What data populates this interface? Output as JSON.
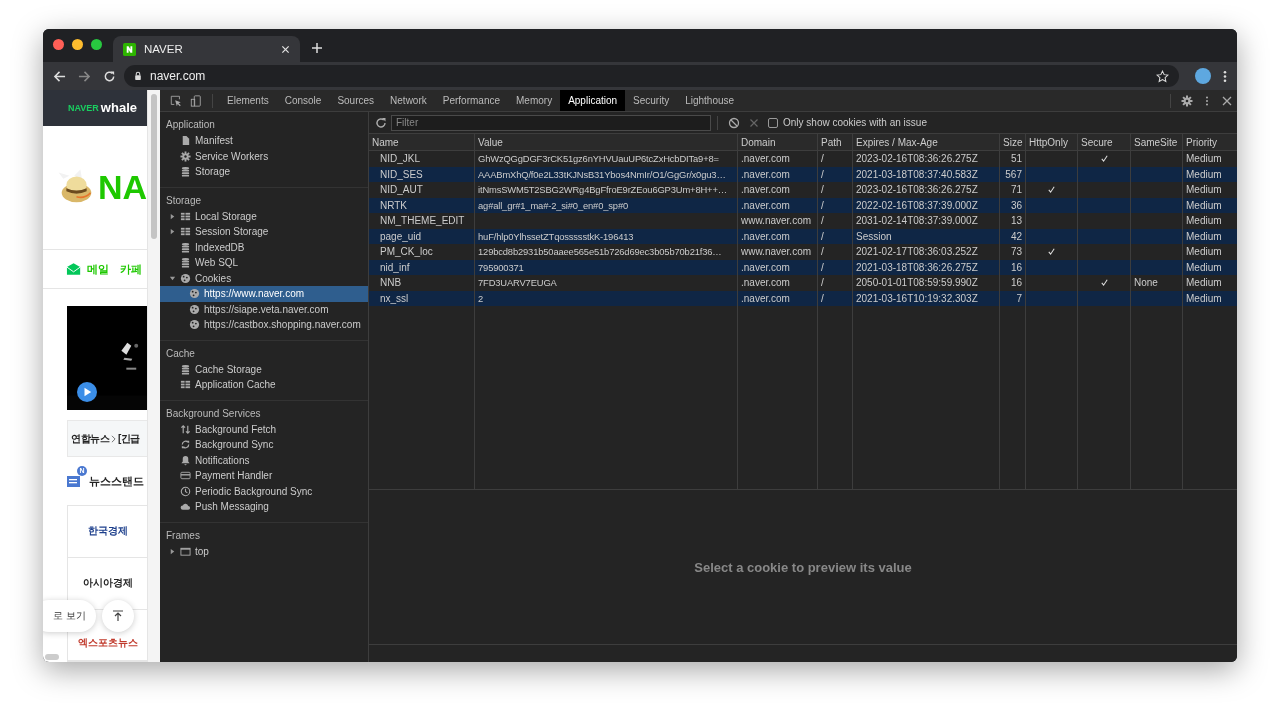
{
  "browser": {
    "tab_title": "NAVER",
    "url": "naver.com"
  },
  "page": {
    "brand_naver": "NAVER",
    "brand_whale": "whale",
    "logo_text": "NA",
    "mail": "메일",
    "cafe": "카페",
    "news_source": "연합뉴스",
    "headline": "[긴급",
    "newsstand": "뉴스스탠드",
    "newsstand_badge": "N",
    "press": [
      "한국경제",
      "아시아경제",
      "엑스포츠뉴스"
    ],
    "view_toggle": "로 보기"
  },
  "devtools": {
    "tabs": [
      {
        "label": "Elements",
        "selected": false
      },
      {
        "label": "Console",
        "selected": false
      },
      {
        "label": "Sources",
        "selected": false
      },
      {
        "label": "Network",
        "selected": false
      },
      {
        "label": "Performance",
        "selected": false
      },
      {
        "label": "Memory",
        "selected": false
      },
      {
        "label": "Application",
        "selected": true
      },
      {
        "label": "Security",
        "selected": false
      },
      {
        "label": "Lighthouse",
        "selected": false
      }
    ],
    "sidebar": [
      {
        "title": "Application",
        "items": [
          {
            "label": "Manifest",
            "kind": "file",
            "selected": false
          },
          {
            "label": "Service Workers",
            "kind": "gear",
            "selected": false
          },
          {
            "label": "Storage",
            "kind": "database",
            "selected": false
          }
        ]
      },
      {
        "title": "Storage",
        "items": [
          {
            "label": "Local Storage",
            "kind": "grid",
            "expanded": false,
            "selected": false
          },
          {
            "label": "Session Storage",
            "kind": "grid",
            "expanded": false,
            "selected": false
          },
          {
            "label": "IndexedDB",
            "kind": "database",
            "selected": false
          },
          {
            "label": "Web SQL",
            "kind": "database",
            "selected": false
          },
          {
            "label": "Cookies",
            "kind": "cookie",
            "expanded": true,
            "selected": false,
            "children": [
              {
                "label": "https://www.naver.com",
                "kind": "cookie",
                "selected": true
              },
              {
                "label": "https://siape.veta.naver.com",
                "kind": "cookie",
                "selected": false
              },
              {
                "label": "https://castbox.shopping.naver.com",
                "kind": "cookie",
                "selected": false
              }
            ]
          }
        ]
      },
      {
        "title": "Cache",
        "items": [
          {
            "label": "Cache Storage",
            "kind": "database",
            "selected": false
          },
          {
            "label": "Application Cache",
            "kind": "grid",
            "selected": false
          }
        ]
      },
      {
        "title": "Background Services",
        "items": [
          {
            "label": "Background Fetch",
            "kind": "updown",
            "selected": false
          },
          {
            "label": "Background Sync",
            "kind": "sync",
            "selected": false
          },
          {
            "label": "Notifications",
            "kind": "bell",
            "selected": false
          },
          {
            "label": "Payment Handler",
            "kind": "card",
            "selected": false
          },
          {
            "label": "Periodic Background Sync",
            "kind": "clock",
            "selected": false
          },
          {
            "label": "Push Messaging",
            "kind": "cloud",
            "selected": false
          }
        ]
      },
      {
        "title": "Frames",
        "items": [
          {
            "label": "top",
            "kind": "frame",
            "expanded": false,
            "selected": false
          }
        ]
      }
    ],
    "filter": {
      "placeholder": "Filter"
    },
    "issue_filter": {
      "label": "Only show cookies with an issue",
      "checked": false
    },
    "table": {
      "columns": [
        "Name",
        "Value",
        "Domain",
        "Path",
        "Expires / Max-Age",
        "Size",
        "HttpOnly",
        "Secure",
        "SameSite",
        "Priority"
      ],
      "rows": [
        {
          "name": "NID_JKL",
          "value": "GhWzQGgDGF3rCK51gz6nYHVUauUP6tcZxHcbDITa9+8=",
          "domain": ".naver.com",
          "path": "/",
          "expires": "2023-02-16T08:36:26.275Z",
          "size": "51",
          "http_only": false,
          "secure": true,
          "priority": "Medium"
        },
        {
          "name": "NID_SES",
          "value": "AAABmXhQ/f0e2L33tKJNsB31Ybos4NmIr/O1/GgGr/x0gu3…",
          "domain": ".naver.com",
          "path": "/",
          "expires": "2021-03-18T08:37:40.583Z",
          "size": "567",
          "http_only": false,
          "secure": false,
          "priority": "Medium"
        },
        {
          "name": "NID_AUT",
          "value": "itNmsSWM5T2SBG2WRg4BgFfroE9rZEou6GP3Um+8H++…",
          "domain": ".naver.com",
          "path": "/",
          "expires": "2023-02-16T08:36:26.275Z",
          "size": "71",
          "http_only": true,
          "secure": false,
          "priority": "Medium"
        },
        {
          "name": "NRTK",
          "value": "ag#all_gr#1_ma#-2_si#0_en#0_sp#0",
          "domain": ".naver.com",
          "path": "/",
          "expires": "2022-02-16T08:37:39.000Z",
          "size": "36",
          "http_only": false,
          "secure": false,
          "priority": "Medium"
        },
        {
          "name": "NM_THEME_EDIT",
          "domain": "www.naver.com",
          "path": "/",
          "expires": "2031-02-14T08:37:39.000Z",
          "size": "13",
          "http_only": false,
          "secure": false,
          "priority": "Medium"
        },
        {
          "name": "page_uid",
          "value": "huF/hlp0YlhssetZTqossssstkK-196413",
          "domain": ".naver.com",
          "path": "/",
          "expires": "Session",
          "size": "42",
          "http_only": false,
          "secure": false,
          "priority": "Medium"
        },
        {
          "name": "PM_CK_loc",
          "value": "129bcd8b2931b50aaee565e51b726d69ec3b05b70b21f36…",
          "domain": "www.naver.com",
          "path": "/",
          "expires": "2021-02-17T08:36:03.252Z",
          "size": "73",
          "http_only": true,
          "secure": false,
          "priority": "Medium"
        },
        {
          "name": "nid_inf",
          "value": "795900371",
          "domain": ".naver.com",
          "path": "/",
          "expires": "2021-03-18T08:36:26.275Z",
          "size": "16",
          "http_only": false,
          "secure": false,
          "priority": "Medium"
        },
        {
          "name": "NNB",
          "value": "7FD3UARV7EUGA",
          "domain": ".naver.com",
          "path": "/",
          "expires": "2050-01-01T08:59:59.990Z",
          "size": "16",
          "http_only": false,
          "secure": true,
          "same_site": "None",
          "priority": "Medium"
        },
        {
          "name": "nx_ssl",
          "value": "2",
          "domain": ".naver.com",
          "path": "/",
          "expires": "2021-03-16T10:19:32.303Z",
          "size": "7",
          "http_only": false,
          "secure": false,
          "priority": "Medium"
        }
      ]
    },
    "preview_message": "Select a cookie to preview its value"
  }
}
